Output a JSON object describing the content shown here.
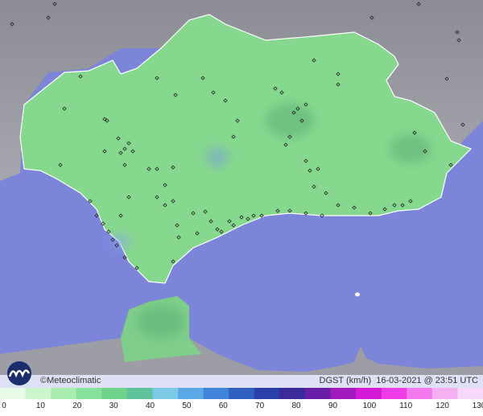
{
  "caption": {
    "brand": "©Meteoclimatic",
    "variable": "DGST (km/h)",
    "timestamp": "16-03-2021 @ 23:51 UTC"
  },
  "scale": {
    "ticks": [
      "0",
      "10",
      "20",
      "30",
      "40",
      "50",
      "60",
      "70",
      "80",
      "90",
      "100",
      "110",
      "120",
      "130"
    ],
    "colors": [
      "#e8fbe8",
      "#ccf5cc",
      "#a8ecb0",
      "#86e29a",
      "#6fd28a",
      "#5ec39a",
      "#7cc9e6",
      "#5aa8e6",
      "#3f84d8",
      "#2f5fc0",
      "#2a3fa8",
      "#3a2a9a",
      "#6a1ea8",
      "#a11ac0",
      "#d41ad6",
      "#f03ce6",
      "#f27aee",
      "#f5b0f2",
      "#f8d8f8"
    ]
  },
  "colors": {
    "sea": "#7d85d9",
    "land_outside": "#9a9aa2",
    "region": "#86d88e"
  }
}
